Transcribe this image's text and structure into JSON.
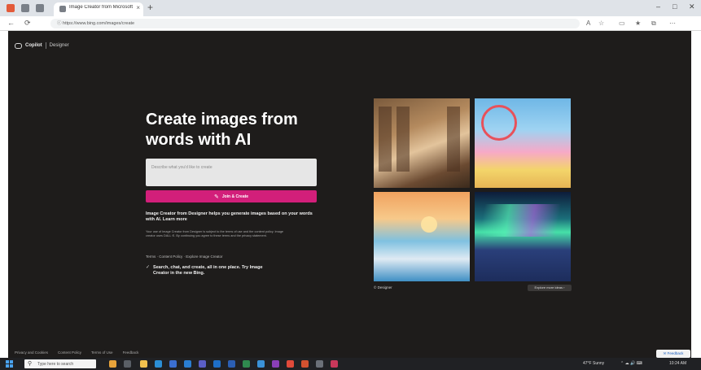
{
  "browser": {
    "tab_title": "Image Creator from Microsoft Designer",
    "tab_close": "×",
    "new_tab": "+",
    "controls": {
      "minimize": "–",
      "maximize": "□",
      "close": "✕"
    },
    "nav": {
      "back": "←",
      "refresh": "⟳",
      "info": "ⓘ"
    },
    "url": "https://www.bing.com/images/create",
    "toolbar_icons": {
      "zoom": "A",
      "favorite": "☆",
      "split": "▭",
      "favorites": "★",
      "collections": "⧉",
      "more": "⋯"
    }
  },
  "page": {
    "brand": {
      "name": "Copilot",
      "sub": "Designer"
    },
    "hero_title": "Create images from words with AI",
    "prompt_placeholder": "Describe what you'd like to create",
    "join_button": {
      "icon": "✎",
      "label": "Join & Create"
    },
    "description": "Image Creator from Designer helps you generate images based on your words with AI. Learn more",
    "fine_print": "Your use of Image Creator from Designer is subject to the terms of use and the content policy. Image creator uses DALL·E. By continuing you agree to these terms and the privacy statement.",
    "links": "Terms · Content Policy · Explore Image Creator",
    "feature": {
      "icon": "✓",
      "text": "Search, chat, and create, all in one place. Try Image Creator in the new Bing."
    },
    "image_credit": "© Designer",
    "share_button": "Explore more ideas ›",
    "footer": {
      "privacy": "Privacy and Cookies",
      "content_policy": "Content Policy",
      "terms": "Terms of Use",
      "feedback": "Feedback"
    },
    "feedback_button": "✉ Feedback"
  },
  "taskbar": {
    "search_placeholder": "Type here to search",
    "search_icon": "⚲",
    "tray": {
      "weather": "47°F Sunny",
      "icons": "⌃ ☁ 🔊 ⌨",
      "time": "10:24 AM"
    },
    "colors": {
      "accent": "#d21f7a",
      "page_bg": "#1e1c1b",
      "taskbar_bg": "#202124"
    }
  }
}
